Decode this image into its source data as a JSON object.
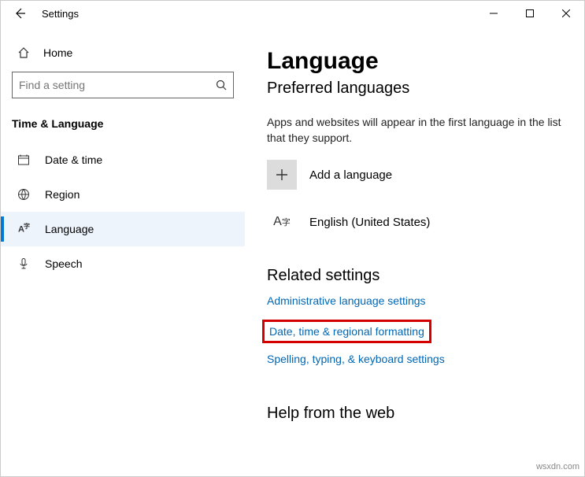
{
  "window": {
    "title": "Settings"
  },
  "sidebar": {
    "home_label": "Home",
    "search_placeholder": "Find a setting",
    "section_heading": "Time & Language",
    "items": [
      {
        "label": "Date & time"
      },
      {
        "label": "Region"
      },
      {
        "label": "Language"
      },
      {
        "label": "Speech"
      }
    ]
  },
  "main": {
    "title": "Language",
    "subtitle": "Preferred languages",
    "description": "Apps and websites will appear in the first language in the list that they support.",
    "add_language_label": "Add a language",
    "installed_language": "English (United States)",
    "related_heading": "Related settings",
    "links": {
      "admin": "Administrative language settings",
      "regional": "Date, time & regional formatting",
      "spelling": "Spelling, typing, & keyboard settings"
    },
    "help_heading": "Help from the web"
  },
  "watermark": "wsxdn.com"
}
